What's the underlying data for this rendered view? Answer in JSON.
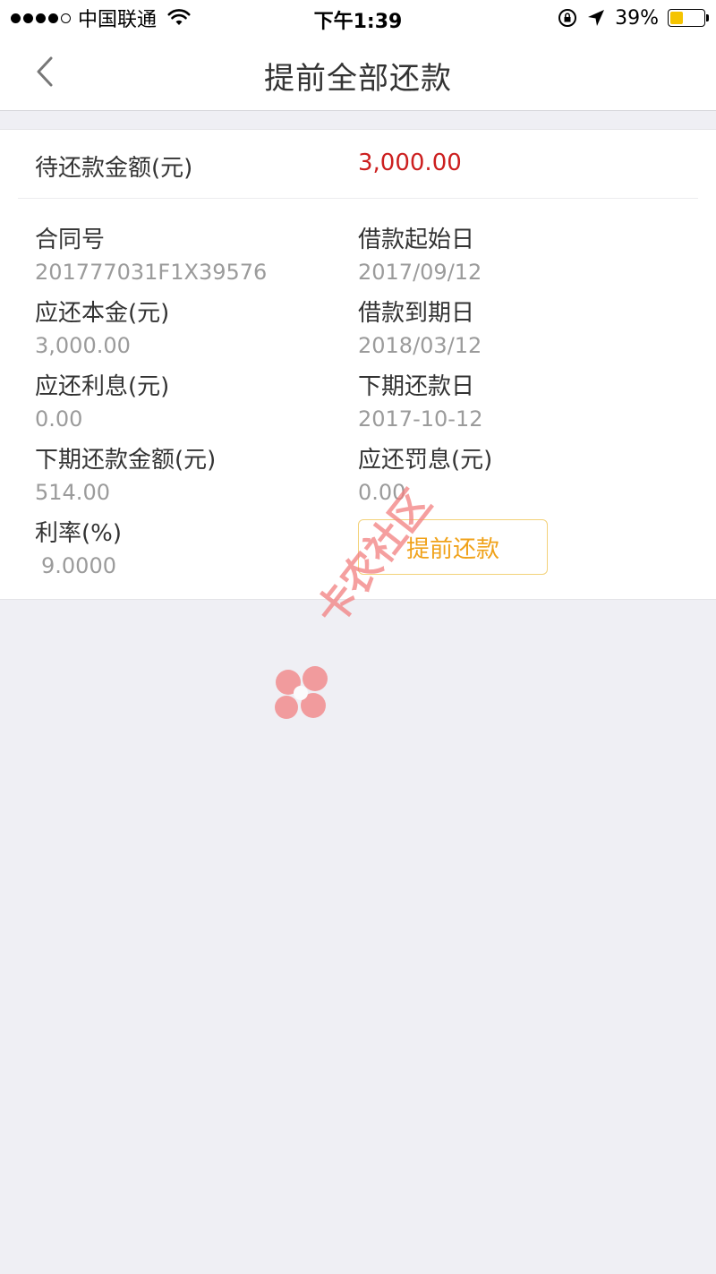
{
  "status_bar": {
    "carrier": "中国联通",
    "time": "下午1:39",
    "battery_percent": "39%",
    "battery_level": 0.39,
    "signal_bars_filled": 4,
    "signal_bars_total": 5
  },
  "nav": {
    "title": "提前全部还款",
    "back_icon": "chevron-left-icon"
  },
  "summary": {
    "label": "待还款金额(元)",
    "value": "3,000.00",
    "value_color": "#cc1f1f"
  },
  "fields": {
    "contract_no": {
      "label": "合同号",
      "value": "201777031F1X39576"
    },
    "loan_start_date": {
      "label": "借款起始日",
      "value": "2017/09/12"
    },
    "principal_due": {
      "label": "应还本金(元)",
      "value": "3,000.00"
    },
    "loan_end_date": {
      "label": "借款到期日",
      "value": "2018/03/12"
    },
    "interest_due": {
      "label": "应还利息(元)",
      "value": "0.00"
    },
    "next_repay_date": {
      "label": "下期还款日",
      "value": "2017-10-12"
    },
    "next_repay_amount": {
      "label": "下期还款金额(元)",
      "value": "514.00"
    },
    "penalty_due": {
      "label": "应还罚息(元)",
      "value": "0.00"
    },
    "interest_rate": {
      "label": "利率(%)",
      "value": "9.0000"
    }
  },
  "actions": {
    "prepay_label": "提前还款",
    "prepay_color": "#f0a21a"
  },
  "watermark": {
    "text": "卡农社区"
  },
  "colors": {
    "background": "#efeff4",
    "card": "#ffffff",
    "label_text": "#333333",
    "value_text": "#9b9b9b"
  }
}
